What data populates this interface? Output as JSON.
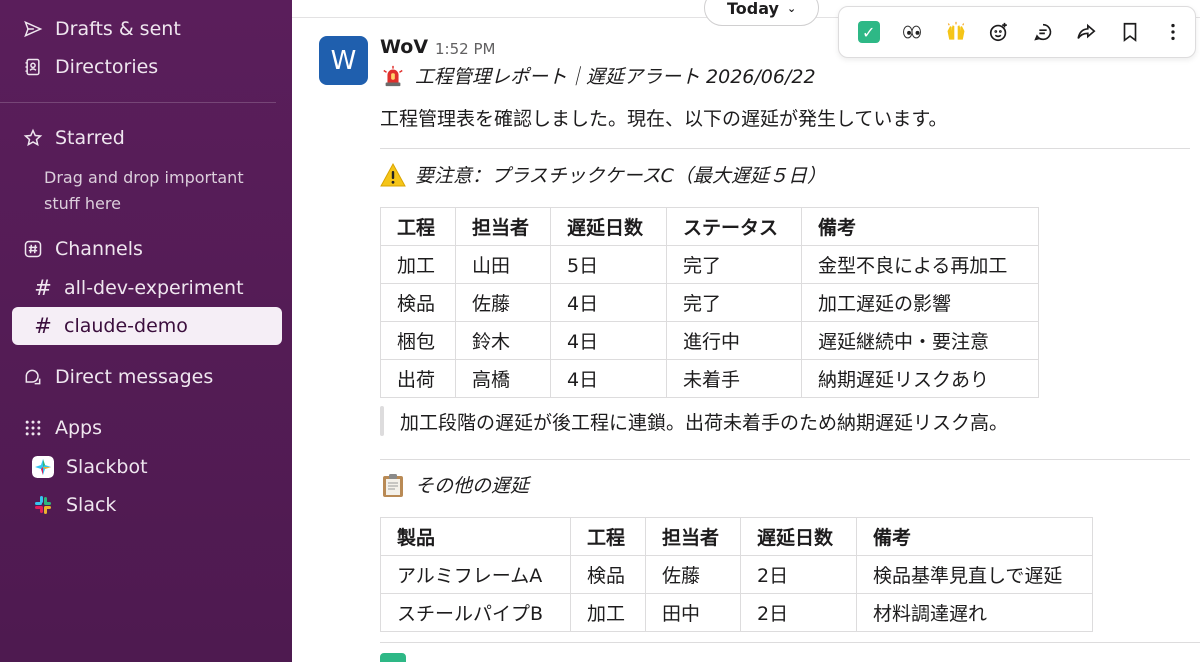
{
  "sidebar": {
    "drafts_label": "Drafts & sent",
    "directories_label": "Directories",
    "starred_label": "Starred",
    "starred_hint": "Drag and drop important stuff here",
    "channels_label": "Channels",
    "channels": [
      {
        "name": "all-dev-experiment",
        "active": false
      },
      {
        "name": "claude-demo",
        "active": true
      }
    ],
    "dm_label": "Direct messages",
    "apps_label": "Apps",
    "apps": [
      {
        "name": "Slackbot",
        "icon": "slackbot-icon"
      },
      {
        "name": "Slack",
        "icon": "slack-icon"
      }
    ]
  },
  "header": {
    "date_divider": "Today"
  },
  "hover_toolbar": {
    "reactions": [
      "✅",
      "👀",
      "🙌"
    ],
    "actions": [
      "add-reaction-icon",
      "reply-in-thread-icon",
      "share-icon",
      "bookmark-icon",
      "more-icon"
    ]
  },
  "message": {
    "avatar_letter": "W",
    "sender": "WoV",
    "time": "1:52 PM",
    "title": "工程管理レポート｜遅延アラート 2026/06/22",
    "intro": "工程管理表を確認しました。現在、以下の遅延が発生しています。",
    "alert_heading": "要注意：プラスチックケースC（最大遅延５日）",
    "alert_table": {
      "headers": [
        "工程",
        "担当者",
        "遅延日数",
        "ステータス",
        "備考"
      ],
      "rows": [
        [
          "加工",
          "山田",
          "5日",
          "完了",
          "金型不良による再加工"
        ],
        [
          "検品",
          "佐藤",
          "4日",
          "完了",
          "加工遅延の影響"
        ],
        [
          "梱包",
          "鈴木",
          "4日",
          "進行中",
          "遅延継続中・要注意"
        ],
        [
          "出荷",
          "高橋",
          "4日",
          "未着手",
          "納期遅延リスクあり"
        ]
      ]
    },
    "alert_note": "加工段階の遅延が後工程に連鎖。出荷未着手のため納期遅延リスク高。",
    "other_heading": "その他の遅延",
    "other_table": {
      "headers": [
        "製品",
        "工程",
        "担当者",
        "遅延日数",
        "備考"
      ],
      "rows": [
        [
          "アルミフレームA",
          "検品",
          "佐藤",
          "2日",
          "検品基準見直しで遅延"
        ],
        [
          "スチールパイプB",
          "加工",
          "田中",
          "2日",
          "材料調達遅れ"
        ]
      ]
    }
  }
}
